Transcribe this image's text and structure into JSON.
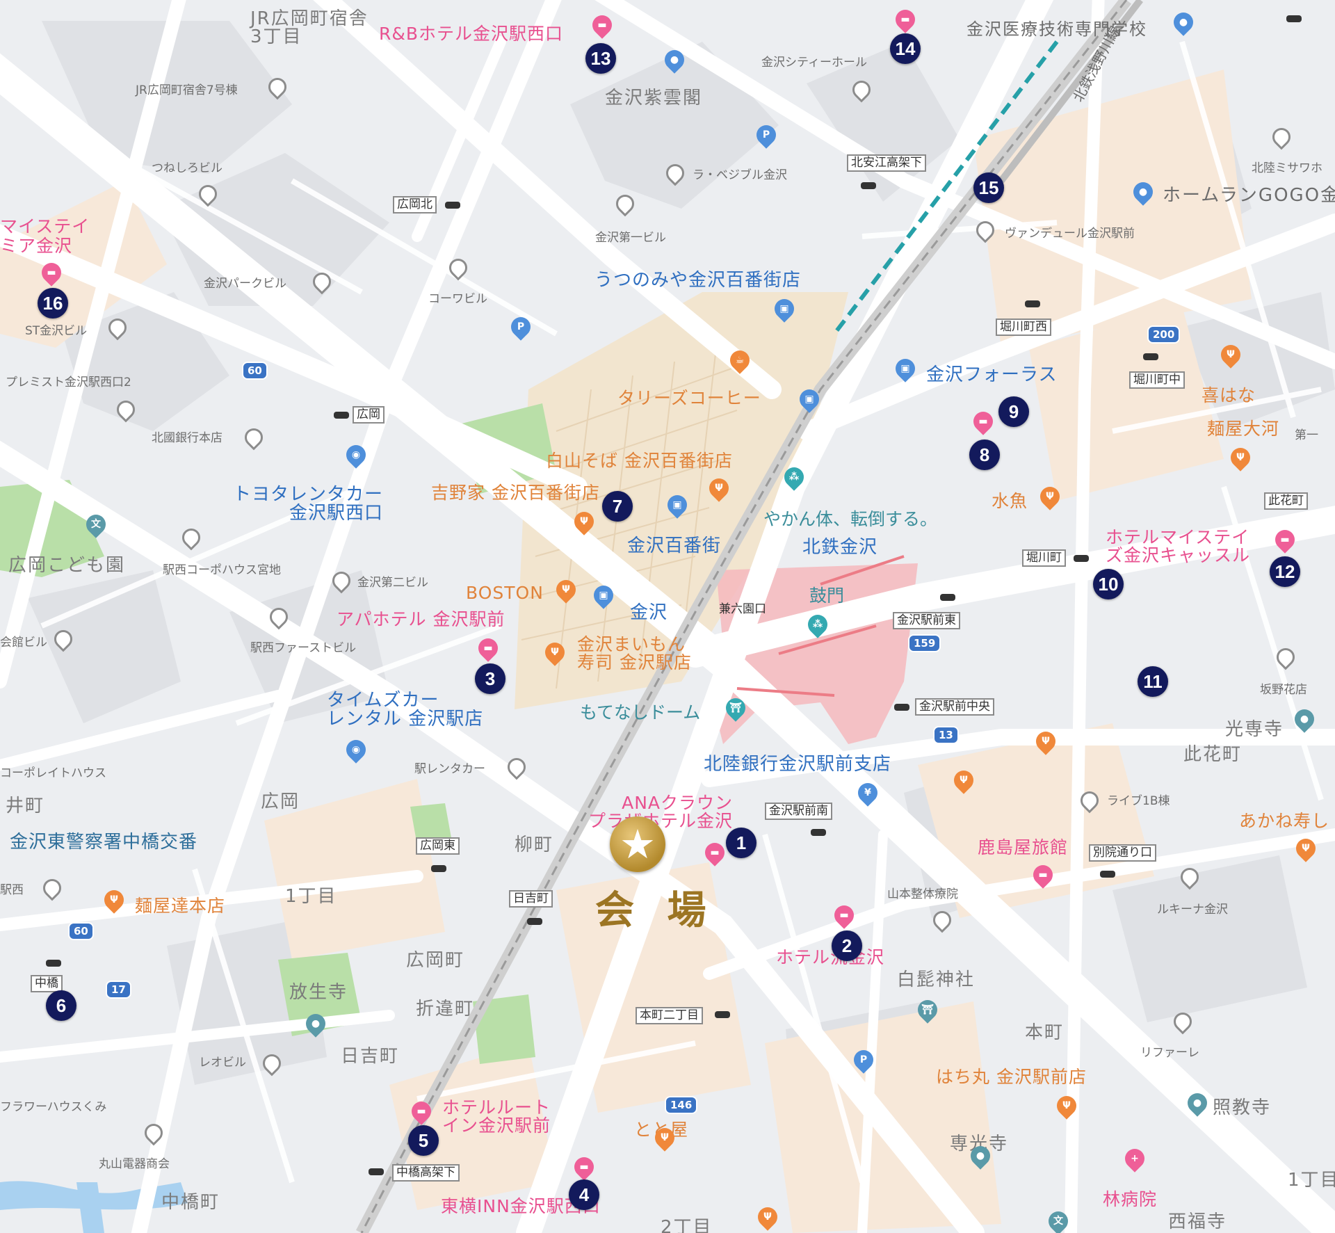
{
  "venue": {
    "label": "会 場",
    "icon": "star-icon"
  },
  "colors": {
    "marker": "#131a5c",
    "hotel": "#e8508f",
    "food": "#e0833a",
    "transit": "#2f6fc0",
    "venue_gold": "#b38a2d",
    "station_area": "#f6b8bd"
  },
  "markers": [
    "1",
    "2",
    "3",
    "4",
    "5",
    "6",
    "7",
    "8",
    "9",
    "10",
    "11",
    "12",
    "13",
    "14",
    "15",
    "16"
  ],
  "labels": {
    "jr_hiroka": "JR広岡町宿舎\n3丁目",
    "rb_hotel": "R&Bホテル金沢駅西口",
    "medical_school": "金沢医療技術専門学校",
    "city_hall": "金沢シティーホール",
    "shiunkaku": "金沢紫雲閣",
    "jr_dorm7": "JR広岡町宿舎7号棟",
    "tsuneshiro": "つねしろビル",
    "la_vegeble": "ラ・ベジブル金沢",
    "kitayasue": "北安江高架下",
    "hokutetsu_line": "北鉄浅野川線",
    "homerun": "ホームランGOGO金",
    "hokuriku_misawa": "北陸ミサワホ",
    "ventdeur": "ヴァンデュール金沢駅前",
    "kanazawa_daiichi": "金沢第一ビル",
    "hirooka_kita": "広岡北",
    "my_stay": "マイステイ\nミア金沢",
    "park_bldg": "金沢パークビル",
    "kowa": "コーワビル",
    "utsunomiya": "うつのみや金沢百番街店",
    "st_bldg": "ST金沢ビル",
    "horikawa_nishi": "堀川町西",
    "premist": "プレミスト金沢駅西口2",
    "hirooka": "広岡",
    "tullys": "タリーズコーヒー",
    "forus": "金沢フォーラス",
    "horikawa_naka": "堀川町中",
    "kihana": "喜はな",
    "menya_taiga": "麺屋大河",
    "daiichi": "第一",
    "hokkoku_bank": "北國銀行本店",
    "hakusan_soba": "白山そば 金沢百番街店",
    "yoshinoya": "吉野家 金沢百番街店",
    "toyota_rent": "トヨタレンタカー\n金沢駅西口",
    "yakan": "やかん体、転倒する。",
    "hokutetsu_kanazawa": "北鉄金沢",
    "suikaku": "水魚",
    "hotel_my_stay_castle": "ホテルマイステイ\nズ金沢キャッスル",
    "konohana": "此花町",
    "horikawa": "堀川町",
    "hiroka_kodomoen": "広岡こども園",
    "ekinishi_coop": "駅西コーポハウス宮地",
    "kanazawa_daini": "金沢第二ビル",
    "hyakubangai": "金沢百番街",
    "boston": "BOSTON",
    "kanazawa": "金沢",
    "kenrokuen_gate": "兼六園口",
    "tsuzumimon": "鼓門",
    "ekimae_higashi": "金沢駅前東",
    "apa_hotel": "アパホテル 金沢駅前",
    "kaikan": "会館ビル",
    "ekinishi_first": "駅西ファーストビル",
    "maimon": "金沢まいもん\n寿司 金沢駅店",
    "ekimae_chuo": "金沢駅前中央",
    "sakano": "坂野花店",
    "times_car": "タイムズカー\nレンタル 金沢駅店",
    "motenashi": "もてなしドーム",
    "koumyouji": "光専寺",
    "konohanamachi": "此花町",
    "eki_rentacar": "駅レンタカー",
    "corporate_house": "コーポレイトハウス",
    "hirooka_area": "広岡",
    "hokuriku_bank": "北陸銀行金沢駅前支店",
    "live1b": "ライブ1B棟",
    "akane_sushi": "あかね寿し",
    "ii_machi": "井町",
    "keisatsu": "金沢東警察署中橋交番",
    "ana_crown": "ANAクラウン\nプラザホテル金沢",
    "ekimae_minami": "金沢駅前南",
    "hirooka_higashi": "広岡東",
    "yanagimachi": "柳町",
    "kashimaya": "鹿島屋旅館",
    "betsuin": "別院通り口",
    "ekinishi": "駅西",
    "menya_tatsu": "麺屋達本店",
    "itchome": "1丁目",
    "hiyoshi": "日吉町",
    "yamamoto": "山本整体療院",
    "lukina": "ルキーナ金沢",
    "nakahashi": "中橋",
    "hirookamachi": "広岡町",
    "hotel_ryu": "ホテル流金沢",
    "hakuhige": "白髭神社",
    "houjouji": "放生寺",
    "orichigai": "折違町",
    "honmachi2": "本町二丁目",
    "honmachi": "本町",
    "hiyoshimachi": "日吉町",
    "leo_bldg": "レオビル",
    "refare": "リファーレ",
    "hachimaru": "はち丸 金沢駅前店",
    "flower_house": "フラワーハウスくみ",
    "hotel_route": "ホテルルート\nイン金沢駅前",
    "totoya": "とと屋",
    "shokouji": "照教寺",
    "senkouji": "専光寺",
    "maruyama": "丸山電器商会",
    "nakahashi_kouka": "中橋高架下",
    "rinbyouin": "林病院",
    "nakahashi_machi": "中橋町",
    "toyoko": "東横INN金沢駅西口",
    "itchome2": "1丁目",
    "saifukuji": "西福寺",
    "nichome": "2丁目"
  },
  "routes": [
    "60",
    "200",
    "159",
    "13",
    "60",
    "17",
    "146"
  ]
}
